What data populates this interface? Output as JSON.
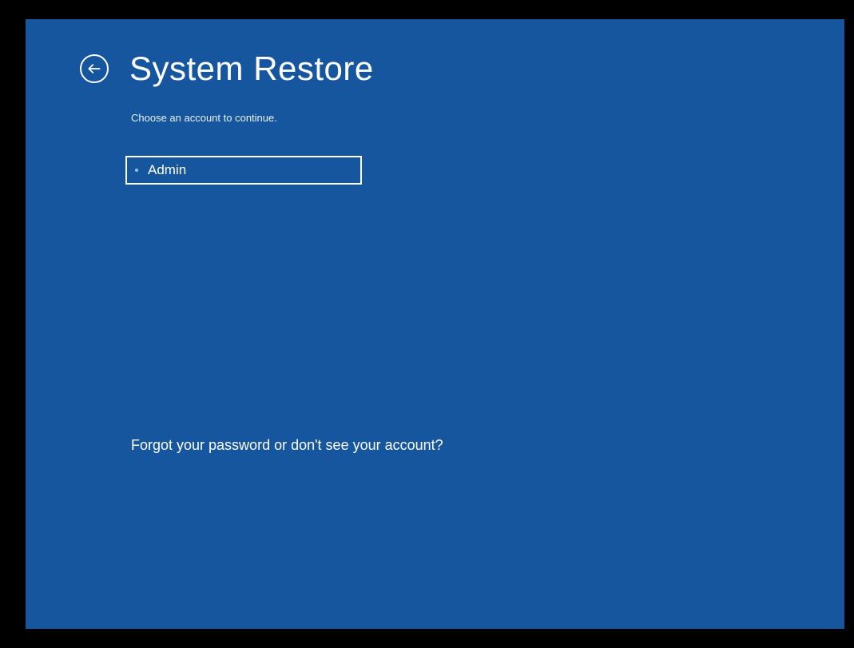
{
  "page": {
    "title": "System Restore",
    "subtitle": "Choose an account to continue."
  },
  "accounts": [
    {
      "name": "Admin"
    }
  ],
  "footer": {
    "forgot_link": "Forgot your password or don't see your account?"
  },
  "colors": {
    "background": "#16569e",
    "text": "#ffffff"
  }
}
